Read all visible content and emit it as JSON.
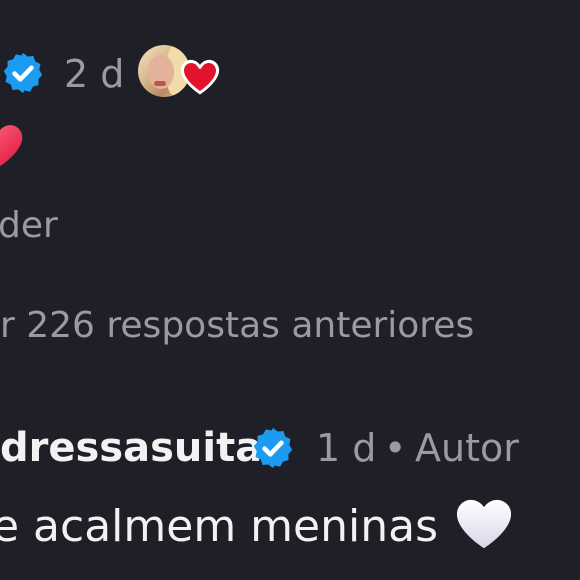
{
  "comment1": {
    "time": "2 d",
    "reply_label": "der"
  },
  "view_replies": {
    "label": "r 226 respostas anteriores"
  },
  "comment2": {
    "username": "dressasuita",
    "time": "1 d",
    "separator": "•",
    "author_tag": "Autor",
    "text": "e acalmem meninas"
  },
  "icons": {
    "verified": "verified-badge-icon",
    "heart_red": "red-heart-icon",
    "heart_white": "white-heart-icon"
  },
  "colors": {
    "background": "#1f2027",
    "verified_blue": "#1d9bf0",
    "heart_red": "#e2132c",
    "meta_gray": "#9a9ba1"
  }
}
